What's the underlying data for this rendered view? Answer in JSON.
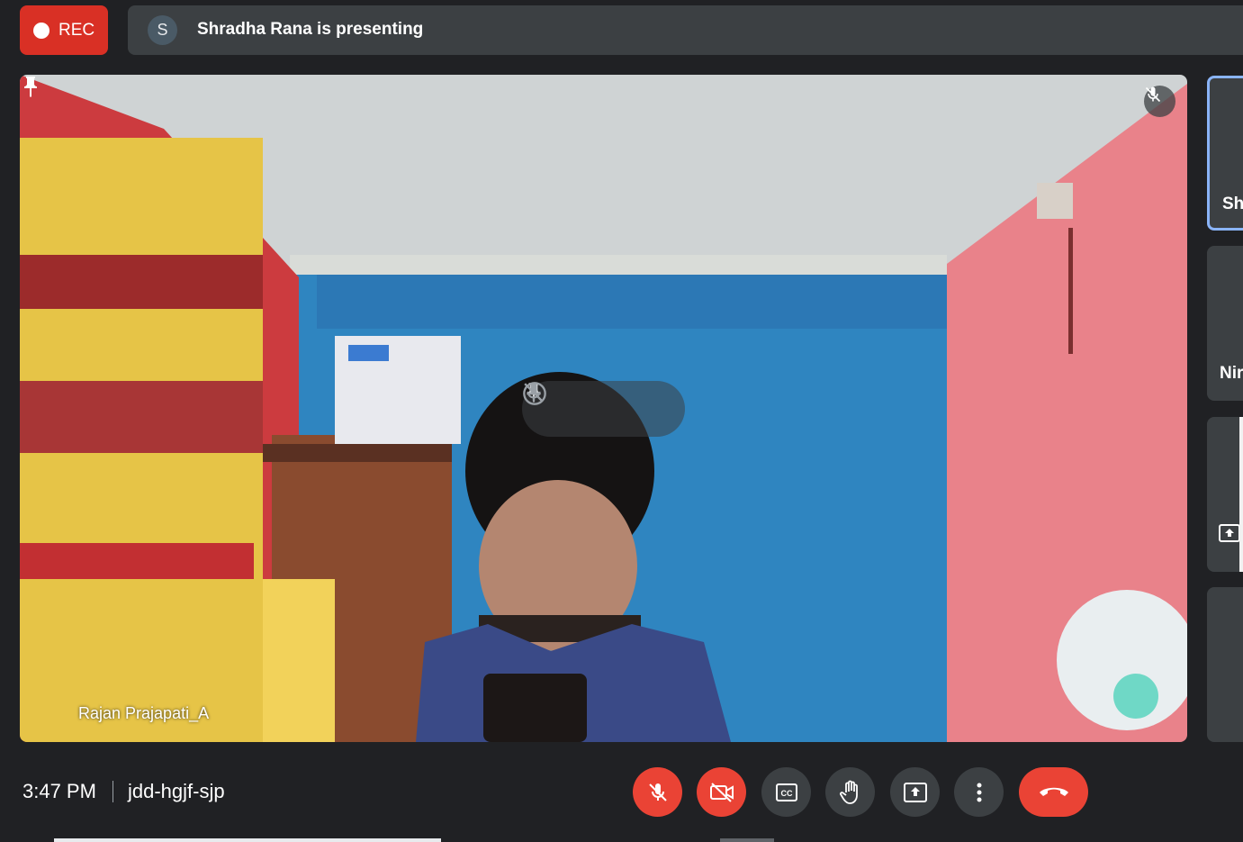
{
  "recording": {
    "label": "REC"
  },
  "presenting_banner": {
    "avatar_initial": "S",
    "text": "Shradha Rana is presenting"
  },
  "main_tile": {
    "participant_name": "Rajan Prajapati_A",
    "muted": true
  },
  "side_tiles": [
    {
      "name": "Sh"
    },
    {
      "name": "Nir"
    },
    {
      "name": ""
    },
    {
      "name": ""
    }
  ],
  "meeting": {
    "time": "3:47 PM",
    "code": "jdd-hgjf-sjp"
  },
  "controls": [
    {
      "icon": "mic-off-icon",
      "state": "off"
    },
    {
      "icon": "camera-off-icon",
      "state": "off"
    },
    {
      "icon": "captions-icon"
    },
    {
      "icon": "raise-hand-icon"
    },
    {
      "icon": "present-screen-icon"
    },
    {
      "icon": "more-options-icon"
    },
    {
      "icon": "leave-call-icon"
    }
  ],
  "colors": {
    "accent_red": "#ea4335",
    "control_gray": "#3c4043",
    "background": "#202124",
    "active_border": "#8ab4f8"
  }
}
